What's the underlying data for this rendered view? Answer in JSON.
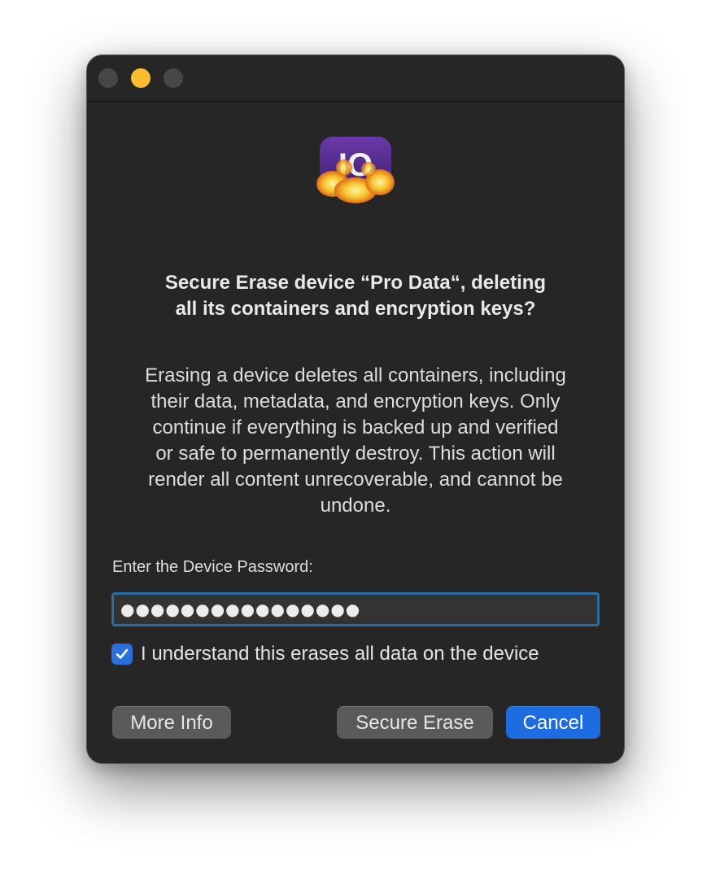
{
  "dialog": {
    "title_line1": "Secure Erase device “Pro Data“, deleting",
    "title_line2": "all its containers and encryption keys?",
    "body_lines": [
      "Erasing a device deletes all containers, including",
      "their data, metadata, and encryption keys. Only",
      "continue if everything is backed up and verified",
      "or safe to permanently destroy. This action will",
      "render all content unrecoverable, and cannot be",
      "undone."
    ],
    "password_label": "Enter the Device Password:",
    "password_value": "●●●●●●●●●●●●●●●●",
    "confirm_checkbox": {
      "label": "I understand this erases all data on the device",
      "checked": true
    },
    "buttons": {
      "more_info": "More Info",
      "secure_erase": "Secure Erase",
      "cancel": "Cancel"
    }
  },
  "app_icon": {
    "text": "IO",
    "icon": "burning-disk-app-icon"
  },
  "colors": {
    "window_bg": "#262626",
    "accent": "#1d6ce0",
    "focus_ring": "#2c6da1",
    "minimize_light": "#febc2e"
  }
}
